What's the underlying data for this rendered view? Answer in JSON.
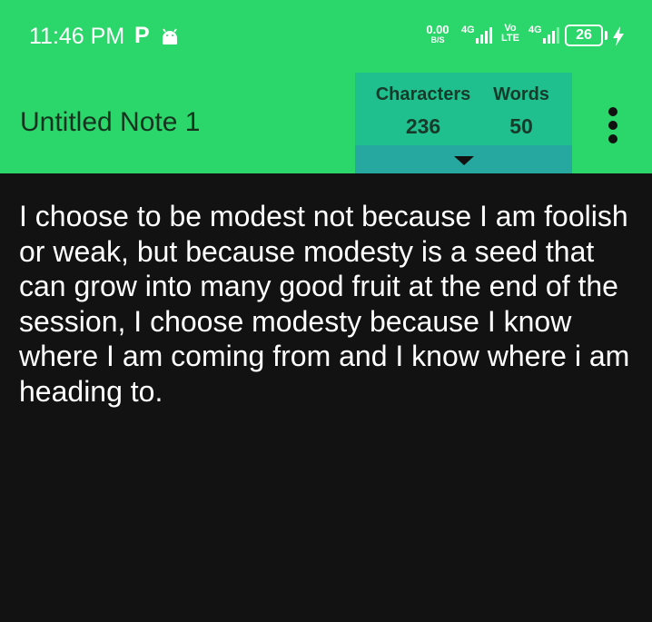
{
  "status_bar": {
    "time": "11:46 PM",
    "notification_letter": "P",
    "net_speed_value": "0.00",
    "net_speed_unit": "B/S",
    "sim1_network": "4G",
    "volte_top": "Vo",
    "volte_bottom": "LTE",
    "sim2_network": "4G",
    "battery_level": "26"
  },
  "app_bar": {
    "note_title": "Untitled Note 1",
    "characters_label": "Characters",
    "characters_count": "236",
    "words_label": "Words",
    "words_count": "50"
  },
  "note": {
    "text": "I choose to be modest not because I am foolish or weak, but because modesty is a seed that can grow into many good fruit at the end of the session, I choose modesty because I know where I am coming from and I know where i am heading to."
  },
  "icons": {
    "notification": "android-icon",
    "charging": "bolt-icon",
    "expand": "caret-down-icon",
    "menu": "more-vertical-icon"
  },
  "colors": {
    "bar_green": "#2bd66a",
    "counter_panel": "#1fbf8e",
    "expand_strip": "#26a8a0",
    "background": "#121212",
    "text": "#ffffff"
  }
}
